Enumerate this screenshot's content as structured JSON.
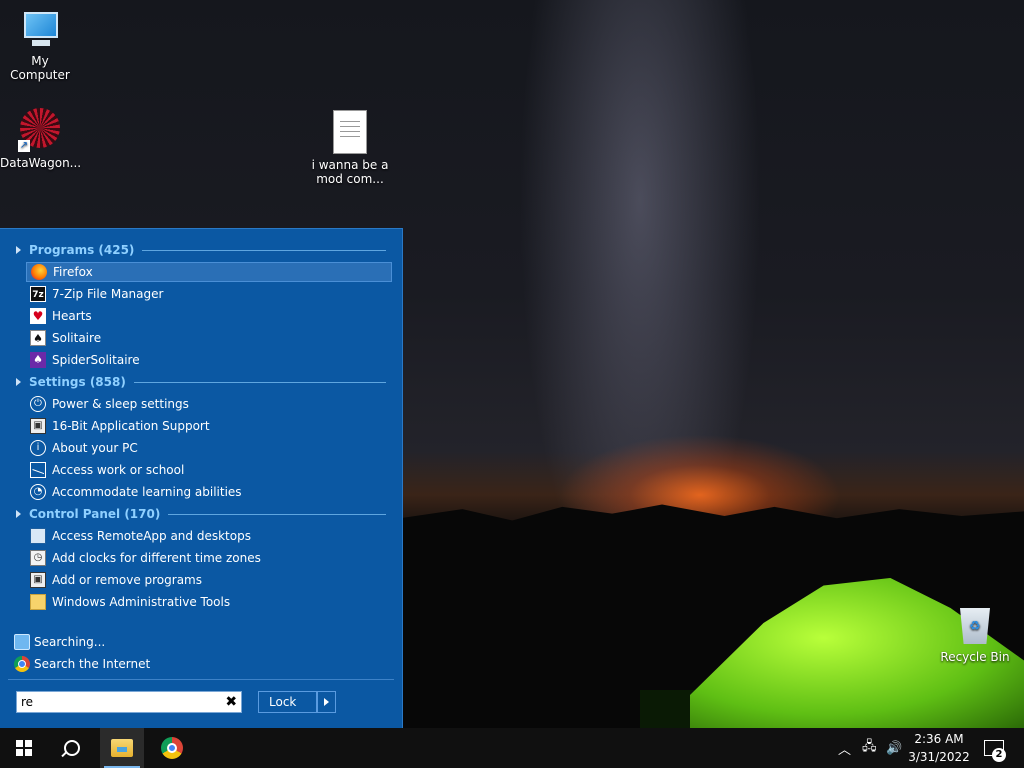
{
  "desktop": {
    "icons": [
      {
        "label": "My Computer"
      },
      {
        "label": "DataWagon..."
      },
      {
        "label_line1": "i wanna be a",
        "label_line2": "mod com..."
      },
      {
        "label": "Recycle Bin"
      }
    ]
  },
  "start_menu": {
    "groups": [
      {
        "header": "Programs (425)",
        "items": [
          {
            "label": "Firefox",
            "icon": "firefox-icon"
          },
          {
            "label": "7-Zip File Manager",
            "icon": "7zip-icon"
          },
          {
            "label": "Hearts",
            "icon": "hearts-icon"
          },
          {
            "label": "Solitaire",
            "icon": "solitaire-icon"
          },
          {
            "label": "SpiderSolitaire",
            "icon": "spider-solitaire-icon"
          }
        ]
      },
      {
        "header": "Settings (858)",
        "items": [
          {
            "label": "Power & sleep settings",
            "icon": "power-icon"
          },
          {
            "label": "16-Bit Application Support",
            "icon": "application-icon"
          },
          {
            "label": "About your PC",
            "icon": "info-icon"
          },
          {
            "label": "Access work or school",
            "icon": "briefcase-icon"
          },
          {
            "label": "Accommodate learning abilities",
            "icon": "accessibility-icon"
          }
        ]
      },
      {
        "header": "Control Panel (170)",
        "items": [
          {
            "label": "Access RemoteApp and desktops",
            "icon": "remote-desktop-icon"
          },
          {
            "label": "Add clocks for different time zones",
            "icon": "clock-icon"
          },
          {
            "label": "Add or remove programs",
            "icon": "programs-icon"
          },
          {
            "label": "Windows Administrative Tools",
            "icon": "folder-icon"
          }
        ]
      }
    ],
    "searching_label": "Searching...",
    "search_internet_label": "Search the Internet",
    "search_value": "re",
    "lock_label": "Lock",
    "accent_color": "#0b58a3"
  },
  "taskbar": {
    "time": "2:36 AM",
    "date": "3/31/2022",
    "notification_count": "2"
  }
}
